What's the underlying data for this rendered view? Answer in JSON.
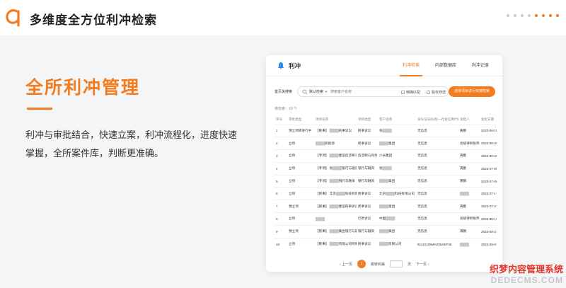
{
  "header": {
    "title": "多维度全方位利冲检索",
    "logo_icon": "brand-a-logo",
    "pager_dots": 8,
    "active_dots": [
      4,
      5,
      6,
      7
    ]
  },
  "hero": {
    "title": "全所利冲管理",
    "description": "利冲与审批结合，快速立案，利冲流程化，进度快速掌握，全所案件库，判断更准确。"
  },
  "app": {
    "title": "利冲",
    "tabs": [
      {
        "label": "利冲检索",
        "active": true
      },
      {
        "label": "内部数据库",
        "active": false
      },
      {
        "label": "利冲记录",
        "active": false
      }
    ],
    "search": {
      "label": "首页关搜索",
      "select_value": "默认检索",
      "placeholder": "搜索客户名称",
      "check_exact": "精确匹配",
      "check_auth": "股权穿透",
      "cta": "选择项目进行快速检索"
    },
    "count": "待检索：10 个",
    "columns": [
      "序号",
      "审批类型",
      "项目名称",
      "项目类型",
      "客户名称",
      "身份证号码/统一社会信用代码",
      "发起人",
      "发起日期"
    ],
    "rows": [
      [
        "1",
        "预立项转进行中",
        "【民事】 ████刑事诉讼",
        "民事诉讼",
        "张████",
        "无信息",
        "黄鹏",
        "2023-06-15"
      ],
      [
        "2",
        "立项",
        "████新能源",
        "民事诉讼",
        "████集团",
        "无信息",
        "高级律师张伟",
        "2023-06-25"
      ],
      [
        "3",
        "立项",
        "【专项】 ████集团反垄断与商...",
        "反垄断与商务...",
        "小米集团",
        "无信息",
        "黄鹏",
        "2023-06-26"
      ],
      [
        "4",
        "立项",
        "【专项】 张████银行与融资",
        "银行与融资",
        "张████",
        "无信息",
        "黄鹏",
        "2023-07-06"
      ],
      [
        "5",
        "立项",
        "【专项】 ████银行与融资",
        "银行与融资",
        "████集团",
        "无信息",
        "黄鹏",
        "2023-07-06"
      ],
      [
        "6",
        "立项",
        "【民事】 北京████科技有限公...",
        "民事诉讼",
        "北京████科技有限公司",
        "无信息",
        "████",
        "2023-07-17"
      ],
      [
        "7",
        "预立项",
        "【民事】 ████集团刑事诉讼",
        "民事诉讼",
        "████集团",
        "无信息",
        "黄鹏",
        "2023-07-27"
      ],
      [
        "8",
        "立项",
        "████",
        "行政诉讼",
        "中国████",
        "无信息",
        "高级律师张伟",
        "2023-08-16"
      ],
      [
        "9",
        "预立项",
        "【民事】 ████集团银行与融资",
        "银行与融资",
        "████集团",
        "无信息",
        "黄鹏",
        "2023-08-21"
      ],
      [
        "10",
        "立项",
        "【民事】 ████有限公司刑事诉讼",
        "民事诉讼",
        "████有限公司",
        "91110105MA005AEF36",
        "████",
        "2023-09-07"
      ]
    ],
    "pager": {
      "prev": "上一页",
      "current": "1",
      "jump": "跳转到第",
      "page_suffix": "页",
      "next": "下一页"
    }
  },
  "watermark": {
    "line1": "织梦内容管理系统",
    "line2": "DEDECMS.COM"
  },
  "colors": {
    "accent": "#f47c20",
    "watermark_red": "#e2352a"
  }
}
